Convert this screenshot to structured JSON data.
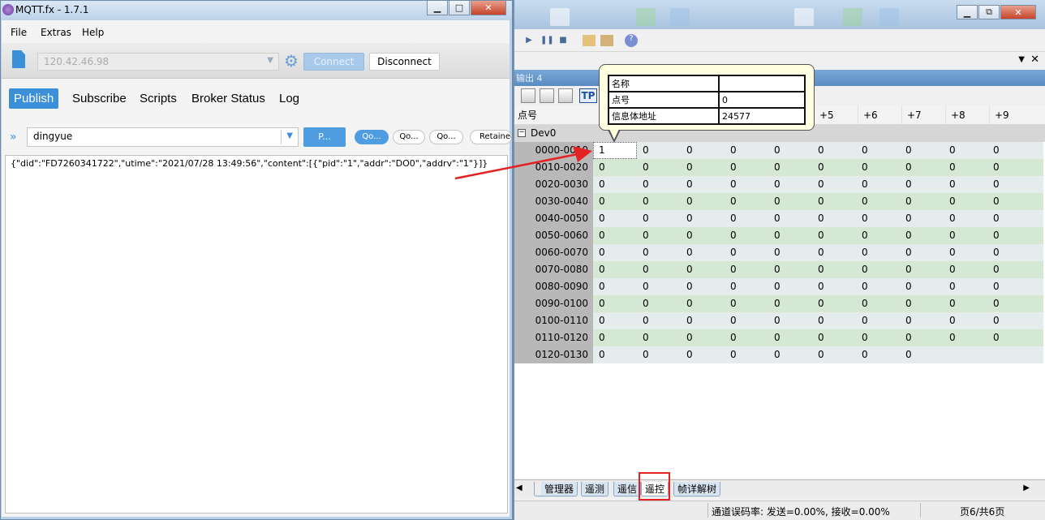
{
  "mqtt": {
    "title": "MQTT.fx - 1.7.1",
    "menu": [
      "File",
      "Extras",
      "Help"
    ],
    "broker": "120.42.46.98",
    "connect_label": "Connect",
    "disconnect_label": "Disconnect",
    "tabs": [
      "Publish",
      "Subscribe",
      "Scripts",
      "Broker Status",
      "Log"
    ],
    "topic": "dingyue",
    "publish_label": "P...",
    "qos": [
      "Qo...",
      "Qo...",
      "Qo..."
    ],
    "retained_label": "Retained",
    "payload": "{\"did\":\"FD7260341722\",\"utime\":\"2021/07/28 13:49:56\",\"content\":[{\"pid\":\"1\",\"addr\":\"DO0\",\"addrv\":\"1\"}]}"
  },
  "right": {
    "output_title": "输出 4",
    "tp_label": "TP",
    "grid": {
      "point_header": "点号",
      "col_headers": [
        "+5",
        "+6",
        "+7",
        "+8",
        "+9"
      ],
      "device": "Dev0",
      "rows": [
        {
          "label": "0000-0010",
          "values": [
            "1",
            "0",
            "0",
            "0",
            "0",
            "0",
            "0",
            "0",
            "0",
            "0"
          ]
        },
        {
          "label": "0010-0020",
          "values": [
            "0",
            "0",
            "0",
            "0",
            "0",
            "0",
            "0",
            "0",
            "0",
            "0"
          ]
        },
        {
          "label": "0020-0030",
          "values": [
            "0",
            "0",
            "0",
            "0",
            "0",
            "0",
            "0",
            "0",
            "0",
            "0"
          ]
        },
        {
          "label": "0030-0040",
          "values": [
            "0",
            "0",
            "0",
            "0",
            "0",
            "0",
            "0",
            "0",
            "0",
            "0"
          ]
        },
        {
          "label": "0040-0050",
          "values": [
            "0",
            "0",
            "0",
            "0",
            "0",
            "0",
            "0",
            "0",
            "0",
            "0"
          ]
        },
        {
          "label": "0050-0060",
          "values": [
            "0",
            "0",
            "0",
            "0",
            "0",
            "0",
            "0",
            "0",
            "0",
            "0"
          ]
        },
        {
          "label": "0060-0070",
          "values": [
            "0",
            "0",
            "0",
            "0",
            "0",
            "0",
            "0",
            "0",
            "0",
            "0"
          ]
        },
        {
          "label": "0070-0080",
          "values": [
            "0",
            "0",
            "0",
            "0",
            "0",
            "0",
            "0",
            "0",
            "0",
            "0"
          ]
        },
        {
          "label": "0080-0090",
          "values": [
            "0",
            "0",
            "0",
            "0",
            "0",
            "0",
            "0",
            "0",
            "0",
            "0"
          ]
        },
        {
          "label": "0090-0100",
          "values": [
            "0",
            "0",
            "0",
            "0",
            "0",
            "0",
            "0",
            "0",
            "0",
            "0"
          ]
        },
        {
          "label": "0100-0110",
          "values": [
            "0",
            "0",
            "0",
            "0",
            "0",
            "0",
            "0",
            "0",
            "0",
            "0"
          ]
        },
        {
          "label": "0110-0120",
          "values": [
            "0",
            "0",
            "0",
            "0",
            "0",
            "0",
            "0",
            "0",
            "0",
            "0"
          ]
        },
        {
          "label": "0120-0130",
          "values": [
            "0",
            "0",
            "0",
            "0",
            "0",
            "0",
            "0",
            "0"
          ]
        }
      ]
    },
    "tooltip": {
      "rows": [
        {
          "key": "名称",
          "value": ""
        },
        {
          "key": "点号",
          "value": "0"
        },
        {
          "key": "信息体地址",
          "value": "24577"
        }
      ]
    },
    "bottom_tabs": [
      "管理器",
      "遥测",
      "遥信",
      "遥控",
      "帧详解树"
    ],
    "status_rate": "通道误码率: 发送=0.00%, 接收=0.00%",
    "status_page": "页6/共6页"
  }
}
